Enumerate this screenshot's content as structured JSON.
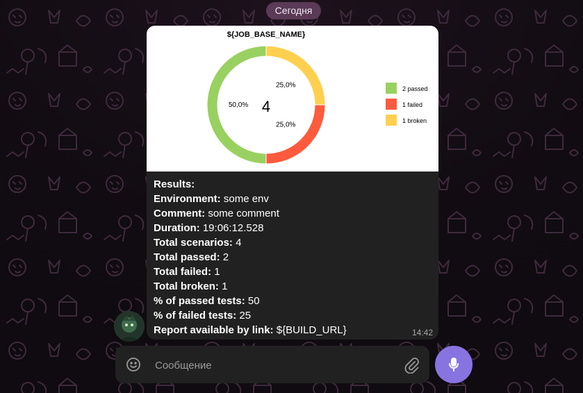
{
  "date_separator": "Сегодня",
  "message": {
    "time": "14:42",
    "lines": [
      {
        "key": "Results:",
        "value": ""
      },
      {
        "key": "Environment:",
        "value": "some env"
      },
      {
        "key": "Comment:",
        "value": "some comment"
      },
      {
        "key": "Duration:",
        "value": "19:06:12.528"
      },
      {
        "key": "Total scenarios:",
        "value": "4"
      },
      {
        "key": "Total passed:",
        "value": "2"
      },
      {
        "key": "Total failed:",
        "value": "1"
      },
      {
        "key": "Total broken:",
        "value": "1"
      },
      {
        "key": "% of passed tests:",
        "value": "50"
      },
      {
        "key": "% of failed tests:",
        "value": "25"
      },
      {
        "key": "Report available by link:",
        "value": "${BUILD_URL}"
      }
    ]
  },
  "chart_data": {
    "type": "pie",
    "title": "${JOB_BASE_NAME}",
    "center_label": "4",
    "slices": [
      {
        "label": "2 passed",
        "value": 2,
        "percent_label": "50,0%",
        "color": "#99d161"
      },
      {
        "label": "1 failed",
        "value": 1,
        "percent_label": "25,0%",
        "color": "#fd5a3e"
      },
      {
        "label": "1 broken",
        "value": 1,
        "percent_label": "25,0%",
        "color": "#ffd050"
      }
    ],
    "legend_position": "right"
  },
  "composer": {
    "placeholder": "Сообщение"
  },
  "icons": {
    "emoji": "smile-icon",
    "attach": "paperclip-icon",
    "mic": "microphone-icon"
  },
  "colors": {
    "accent": "#8774e1",
    "bubble": "#212121",
    "date_pill": "#5a3a57"
  }
}
